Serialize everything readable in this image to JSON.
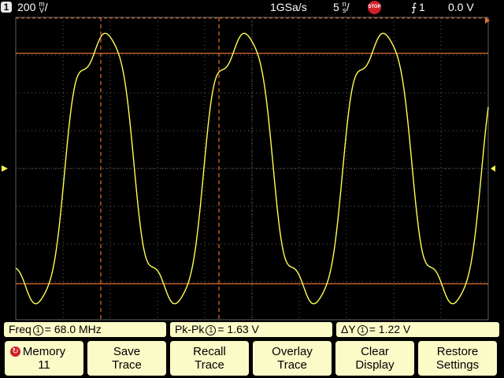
{
  "topbar": {
    "channel": "1",
    "scale_value": "200",
    "scale_unit_top": "m",
    "scale_unit_bottom": "V",
    "sample_rate": "1GSa/s",
    "timebase_value": "5",
    "timebase_unit_top": "n",
    "timebase_unit_bottom": "s",
    "run_state": "STOP",
    "trigger_source": "1",
    "trigger_level": "0.0 V"
  },
  "colors": {
    "trace": "#ffff50",
    "cursor": "#e07030",
    "grid": "#606060",
    "softkey": "#fbfbc8",
    "stop": "#d0202a"
  },
  "measurements": [
    {
      "label": "Freq",
      "channel": "1",
      "value": "68.0 MHz"
    },
    {
      "label": "Pk-Pk",
      "channel": "1",
      "value": "1.63 V"
    },
    {
      "label": "ΔY",
      "channel": "1",
      "value": "1.22 V"
    }
  ],
  "softkeys": [
    {
      "line1": "Memory",
      "line2": "11"
    },
    {
      "line1": "Save",
      "line2": "Trace"
    },
    {
      "line1": "Recall",
      "line2": "Trace"
    },
    {
      "line1": "Overlay",
      "line2": "Trace"
    },
    {
      "line1": "Clear",
      "line2": "Display"
    },
    {
      "line1": "Restore",
      "line2": "Settings"
    }
  ],
  "waveform": {
    "frequency_mhz": 68.0,
    "peak_to_peak_v": 1.63,
    "volts_per_div": 0.2,
    "ns_per_div": 5,
    "offset_v": 0.0
  },
  "cursors": {
    "y1_v": 0.61,
    "y2_v": -0.61,
    "x1_ns": 9.0,
    "x2_ns": 21.5
  }
}
